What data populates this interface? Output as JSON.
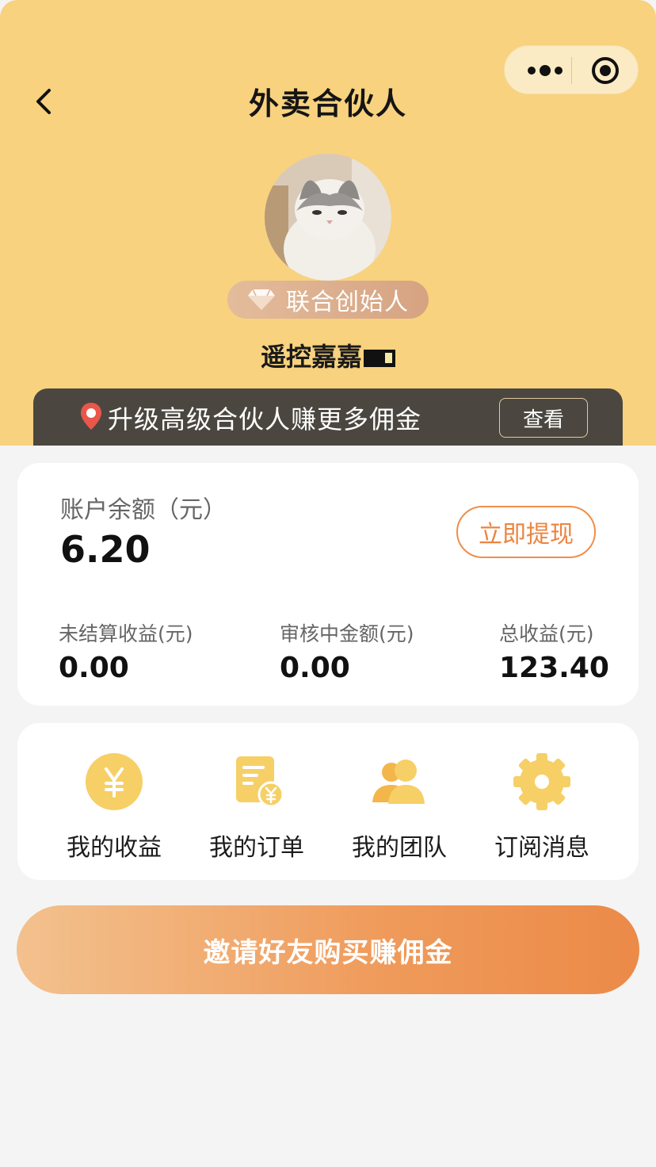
{
  "header": {
    "title": "外卖合伙人",
    "back_icon": "chevron-left-icon",
    "capsule": {
      "more_icon": "more-dots-icon",
      "close_icon": "target-close-icon"
    }
  },
  "profile": {
    "avatar": "cat-avatar",
    "rank": "联合创始人",
    "rank_icon": "diamond-icon",
    "username": "遥控嘉嘉"
  },
  "upgrade": {
    "icon": "pin-badge-icon",
    "text": "升级高级合伙人赚更多佣金",
    "button": "查看"
  },
  "balance": {
    "label": "账户余额（元）",
    "value": "6.20",
    "withdraw_button": "立即提现",
    "stats": [
      {
        "label": "未结算收益(元)",
        "value": "0.00"
      },
      {
        "label": "审核中金额(元)",
        "value": "0.00"
      },
      {
        "label": "总收益(元)",
        "value": "123.40"
      }
    ]
  },
  "menu": [
    {
      "label": "我的收益",
      "icon": "yen-coin-icon"
    },
    {
      "label": "我的订单",
      "icon": "order-doc-icon"
    },
    {
      "label": "我的团队",
      "icon": "team-icon"
    },
    {
      "label": "订阅消息",
      "icon": "gear-icon"
    }
  ],
  "invite_button": "邀请好友购买赚佣金",
  "colors": {
    "header_bg": "#f8d27e",
    "accent_orange": "#ec8440",
    "icon_yellow": "#f6cf66",
    "upgrade_bar": "#4b4740"
  }
}
